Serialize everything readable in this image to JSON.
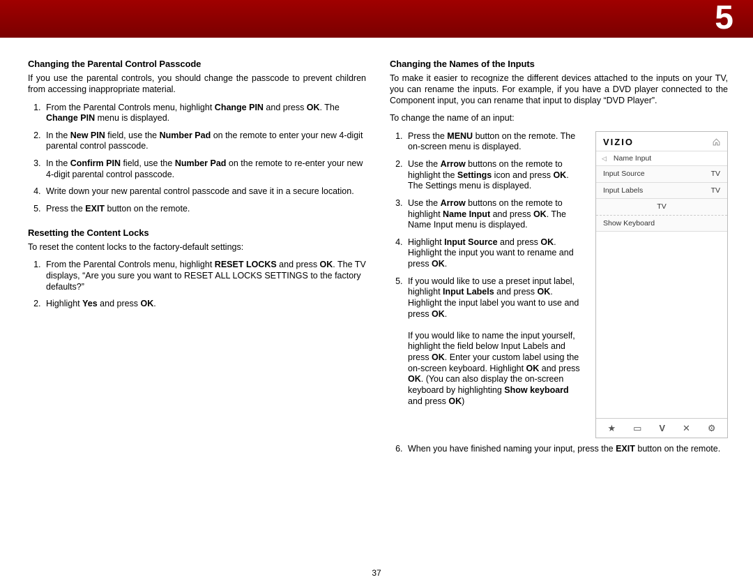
{
  "chapter": "5",
  "pageNumber": "37",
  "left": {
    "h1": "Changing the Parental Control Passcode",
    "p1": "If you use the parental controls, you should change the passcode to prevent children from accessing inappropriate material.",
    "l1a": "From the Parental Controls menu, highlight ",
    "l1b": "Change PIN",
    "l1c": " and press ",
    "l1d": "OK",
    "l1e": ". The ",
    "l1f": "Change PIN",
    "l1g": " menu is displayed.",
    "l2a": "In the ",
    "l2b": "New PIN",
    "l2c": " field, use the ",
    "l2d": "Number Pad",
    "l2e": " on the remote to enter your new 4-digit parental control passcode.",
    "l3a": "In the ",
    "l3b": "Confirm PIN",
    "l3c": " field, use the ",
    "l3d": "Number Pad",
    "l3e": " on the remote to re-enter your new 4-digit parental control passcode.",
    "l4": "Write down your new parental control passcode and save it in a secure location.",
    "l5a": "Press the ",
    "l5b": "EXIT",
    "l5c": " button on the remote.",
    "h2": "Resetting the Content Locks",
    "p2": "To reset the content locks to the factory-default settings:",
    "r1a": "From the Parental Controls menu, highlight ",
    "r1b": "RESET LOCKS",
    "r1c": " and press ",
    "r1d": "OK",
    "r1e": ". The TV displays, “Are you sure you want to RESET ALL LOCKS SETTINGS to the factory defaults?”",
    "r2a": "Highlight ",
    "r2b": "Yes",
    "r2c": " and press ",
    "r2d": "OK",
    "r2e": "."
  },
  "right": {
    "h1": "Changing the Names of the Inputs",
    "p1": "To make it easier to recognize the different devices attached to the inputs on your TV, you can rename the inputs. For example, if you have a DVD player connected to the Component input, you can rename that input to display “DVD Player”.",
    "p2": "To change the name of an input:",
    "s1a": "Press the ",
    "s1b": "MENU",
    "s1c": " button on the remote. The on-screen menu is displayed.",
    "s2a": "Use the ",
    "s2b": "Arrow",
    "s2c": " buttons on the remote to highlight the ",
    "s2d": "Settings",
    "s2e": " icon and press ",
    "s2f": "OK",
    "s2g": ". The Settings menu is displayed.",
    "s3a": "Use the ",
    "s3b": "Arrow",
    "s3c": " buttons on the remote to highlight ",
    "s3d": "Name Input",
    "s3e": " and press ",
    "s3f": "OK",
    "s3g": ". The Name Input menu is displayed.",
    "s4a": "Highlight ",
    "s4b": "Input Source",
    "s4c": " and press ",
    "s4d": "OK",
    "s4e": ". Highlight the input you want to rename and press ",
    "s4f": "OK",
    "s4g": ".",
    "s5a": "If you would like to use a preset input label, highlight ",
    "s5b": "Input Labels",
    "s5c": " and press ",
    "s5d": "OK",
    "s5e": ". Highlight the input label you want to use and press ",
    "s5f": "OK",
    "s5g": ".",
    "s5p2a": "If you would like to name the input yourself, highlight the field below Input Labels and press ",
    "s5p2b": "OK",
    "s5p2c": ". Enter your custom label using the on-screen keyboard. Highlight ",
    "s5p2d": "OK",
    "s5p2e": " and press ",
    "s5p2f": "OK",
    "s5p2g": ". (You can also display the on-screen keyboard by highlighting ",
    "s5p2h": "Show keyboard",
    "s5p2i": " and press ",
    "s5p2j": "OK",
    "s5p2k": ")",
    "s6a": "When you have finished naming your input, press the ",
    "s6b": "EXIT",
    "s6c": " button on the remote."
  },
  "menu": {
    "logo": "VIZIO",
    "crumb": "Name Input",
    "row1l": "Input Source",
    "row1r": "TV",
    "row2l": "Input Labels",
    "row2r": "TV",
    "row3": "TV",
    "row4": "Show Keyboard",
    "foot1": "★",
    "foot2": "▭",
    "foot3": "V",
    "foot4": "✕",
    "foot5": "⚙"
  }
}
